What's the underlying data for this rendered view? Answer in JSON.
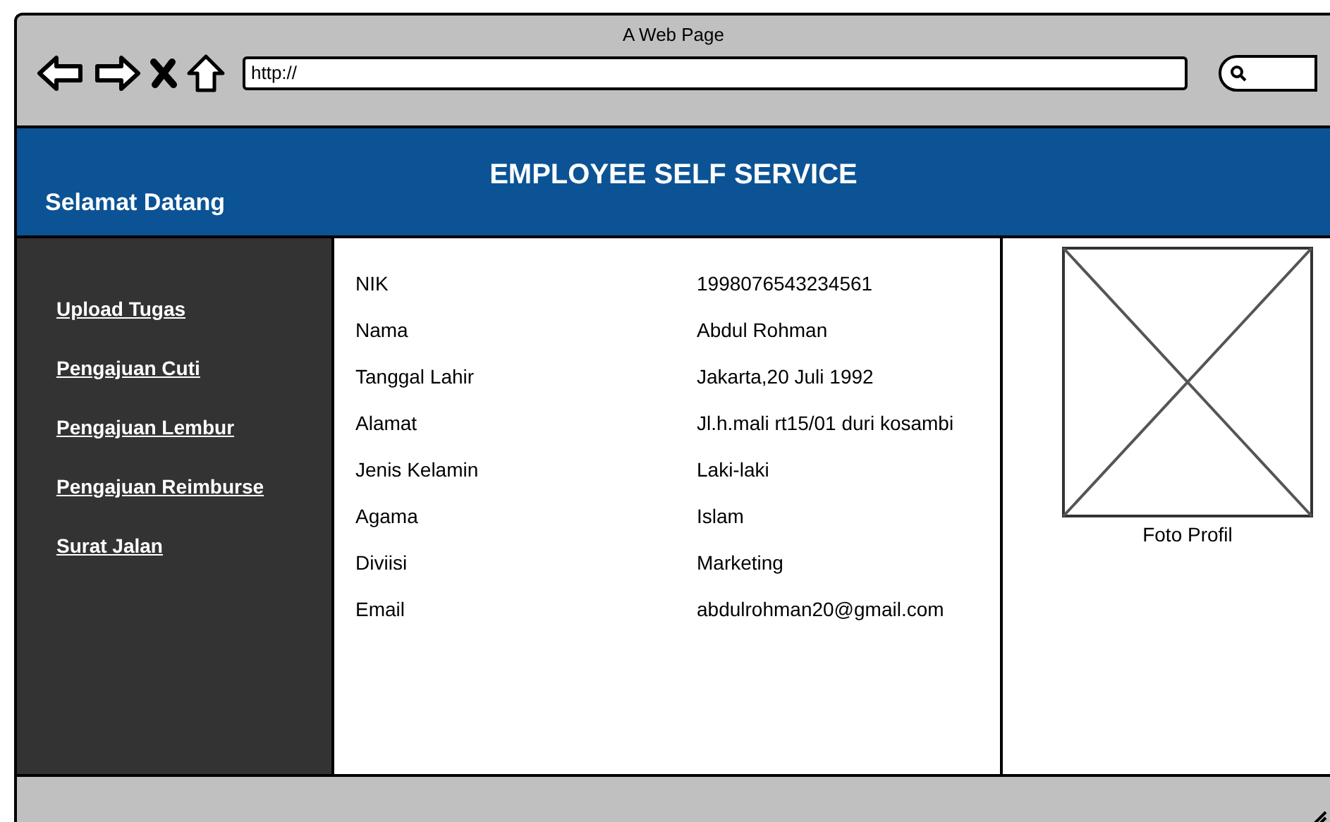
{
  "browser": {
    "title": "A Web Page",
    "url": "http://"
  },
  "header": {
    "title": "EMPLOYEE SELF SERVICE",
    "greeting": "Selamat Datang"
  },
  "sidebar": {
    "items": [
      {
        "label": "Upload Tugas"
      },
      {
        "label": "Pengajuan Cuti"
      },
      {
        "label": "Pengajuan Lembur"
      },
      {
        "label": "Pengajuan Reimburse"
      },
      {
        "label": "Surat Jalan"
      }
    ]
  },
  "profile": {
    "fields": [
      {
        "label": "NIK",
        "value": "1998076543234561"
      },
      {
        "label": "Nama",
        "value": "Abdul Rohman"
      },
      {
        "label": "Tanggal Lahir",
        "value": "Jakarta,20 Juli 1992"
      },
      {
        "label": "Alamat",
        "value": "Jl.h.mali rt15/01 duri kosambi"
      },
      {
        "label": "Jenis Kelamin",
        "value": "Laki-laki"
      },
      {
        "label": "Agama",
        "value": "Islam"
      },
      {
        "label": "Diviisi",
        "value": "Marketing"
      },
      {
        "label": "Email",
        "value": "abdulrohman20@gmail.com"
      }
    ],
    "photo_caption": "Foto Profil"
  }
}
